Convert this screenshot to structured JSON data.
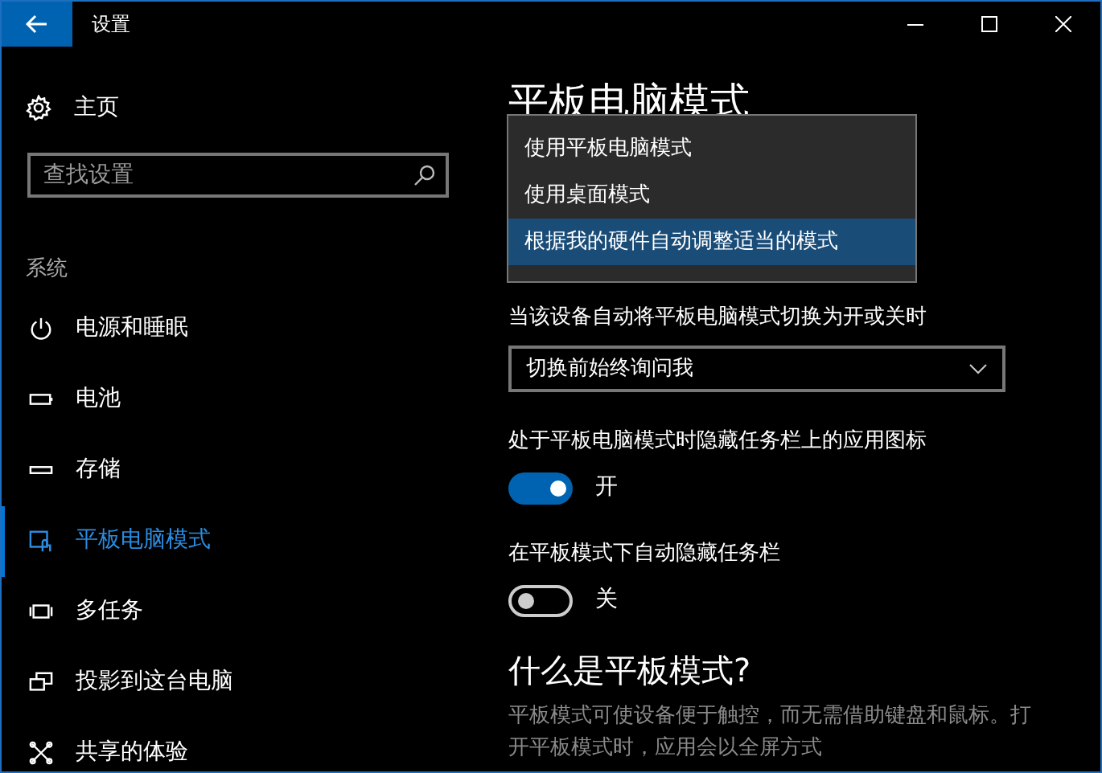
{
  "window": {
    "title": "设置"
  },
  "sidebar": {
    "home": "主页",
    "search": {
      "placeholder": "查找设置"
    },
    "section": "系统",
    "items": [
      {
        "label": "电源和睡眠",
        "selected": false
      },
      {
        "label": "电池",
        "selected": false
      },
      {
        "label": "存储",
        "selected": false
      },
      {
        "label": "平板电脑模式",
        "selected": true
      },
      {
        "label": "多任务",
        "selected": false
      },
      {
        "label": "投影到这台电脑",
        "selected": false
      },
      {
        "label": "共享的体验",
        "selected": false
      }
    ]
  },
  "main": {
    "title": "平板电脑模式",
    "dropdown_menu": {
      "options": [
        {
          "label": "使用平板电脑模式",
          "selected": false
        },
        {
          "label": "使用桌面模式",
          "selected": false
        },
        {
          "label": "根据我的硬件自动调整适当的模式",
          "selected": true
        }
      ]
    },
    "settings": [
      {
        "kind": "select",
        "label": "当该设备自动将平板电脑模式切换为开或关时",
        "value": "切换前始终询问我"
      },
      {
        "kind": "toggle",
        "label": "处于平板电脑模式时隐藏任务栏上的应用图标",
        "on": true,
        "state_text": "开"
      },
      {
        "kind": "toggle",
        "label": "在平板模式下自动隐藏任务栏",
        "on": false,
        "state_text": "关"
      }
    ],
    "about": {
      "heading": "什么是平板模式?",
      "lines": [
        "平板模式可使设备便于触控，而无需借助键盘和鼠标。打",
        "开平板模式时，应用会以全屏方式"
      ]
    }
  }
}
